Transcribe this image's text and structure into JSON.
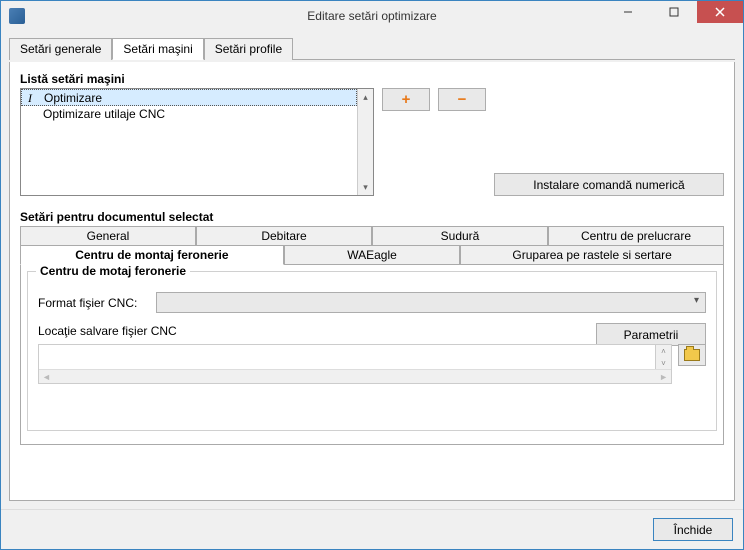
{
  "window": {
    "title": "Editare setări optimizare"
  },
  "outer_tabs": {
    "t0": "Setări generale",
    "t1": "Setări maşini",
    "t2": "Setări profile"
  },
  "machine_list": {
    "label": "Listă setări maşini",
    "items": [
      "Optimizare",
      "Optimizare utilaje CNC"
    ]
  },
  "buttons": {
    "add": "+",
    "remove": "−",
    "install_cnc": "Instalare comandă numerică",
    "params": "Parametrii",
    "close": "Închide"
  },
  "doc_section": {
    "label": "Setări pentru documentul selectat"
  },
  "inner_tabs": {
    "row1": [
      "General",
      "Debitare",
      "Sudură",
      "Centru de prelucrare"
    ],
    "row2": [
      "Centru de montaj feronerie",
      "WAEagle",
      "Gruparea pe rastele si sertare"
    ]
  },
  "groupbox": {
    "title": "Centru de motaj feronerie",
    "format_label": "Format fişier CNC:",
    "save_label": "Locaţie salvare fişier CNC"
  }
}
